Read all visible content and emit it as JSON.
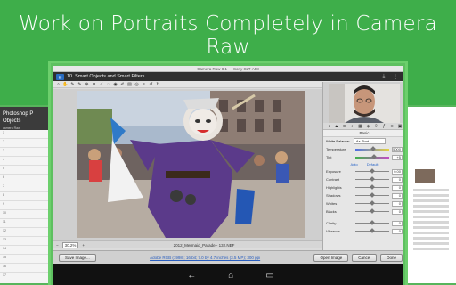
{
  "headline": "Work on Portraits Completely in Camera Raw",
  "left_panel": {
    "title": "Photoshop P",
    "title2": "Objects",
    "subtitle": "camera Raw",
    "rows": [
      "1",
      "2",
      "3",
      "4",
      "5",
      "6",
      "7",
      "8",
      "9",
      "10",
      "11",
      "12",
      "13",
      "14",
      "15",
      "16",
      "17"
    ]
  },
  "system_bar": "Camera Raw 8.1 — Sony SLT-A58",
  "app": {
    "chapter": "10. Smart Objects and Smart Filters"
  },
  "toolbar": {
    "tools": [
      "zoom-tool",
      "hand-tool",
      "white-balance-tool",
      "color-sampler-tool",
      "targeted-adjustment-tool",
      "crop-tool",
      "straighten-tool",
      "spot-removal-tool",
      "red-eye-tool",
      "adjustment-brush-tool",
      "graduated-filter-tool",
      "radial-filter-tool",
      "preferences-tool",
      "rotate-left-tool",
      "rotate-right-tool"
    ],
    "preview_label": "Preview"
  },
  "status": {
    "zoom": "30.2%",
    "filename": "2012_Mermaid_Parade - 132.NEF"
  },
  "panel": {
    "tab_title": "Basic",
    "white_balance_label": "White Balance:",
    "white_balance_value": "As Shot",
    "auto": "Auto",
    "default": "Default",
    "sliders": [
      {
        "label": "Temperature",
        "value": "5000",
        "pos": 0.52,
        "style": "temp"
      },
      {
        "label": "Tint",
        "value": "+5",
        "pos": 0.55,
        "style": "tint"
      },
      {
        "label": "Exposure",
        "value": "0.00",
        "pos": 0.5,
        "style": "plain"
      },
      {
        "label": "Contrast",
        "value": "0",
        "pos": 0.5,
        "style": "plain"
      },
      {
        "label": "Highlights",
        "value": "0",
        "pos": 0.5,
        "style": "plain"
      },
      {
        "label": "Shadows",
        "value": "0",
        "pos": 0.5,
        "style": "plain"
      },
      {
        "label": "Whites",
        "value": "0",
        "pos": 0.5,
        "style": "plain"
      },
      {
        "label": "Blacks",
        "value": "0",
        "pos": 0.5,
        "style": "plain"
      },
      {
        "label": "Clarity",
        "value": "0",
        "pos": 0.5,
        "style": "plain"
      },
      {
        "label": "Vibrance",
        "value": "0",
        "pos": 0.5,
        "style": "plain"
      }
    ]
  },
  "bottom": {
    "save_label": "Save Image...",
    "info": "Adobe RGB (1998); 16 bit; 7.0 by 4.7 inches (3.5 MP); 300 ppi",
    "open_label": "Open Image",
    "cancel_label": "Cancel",
    "done_label": "Done"
  },
  "nav": {
    "back": "←",
    "home": "⌂",
    "recent": "▭"
  }
}
